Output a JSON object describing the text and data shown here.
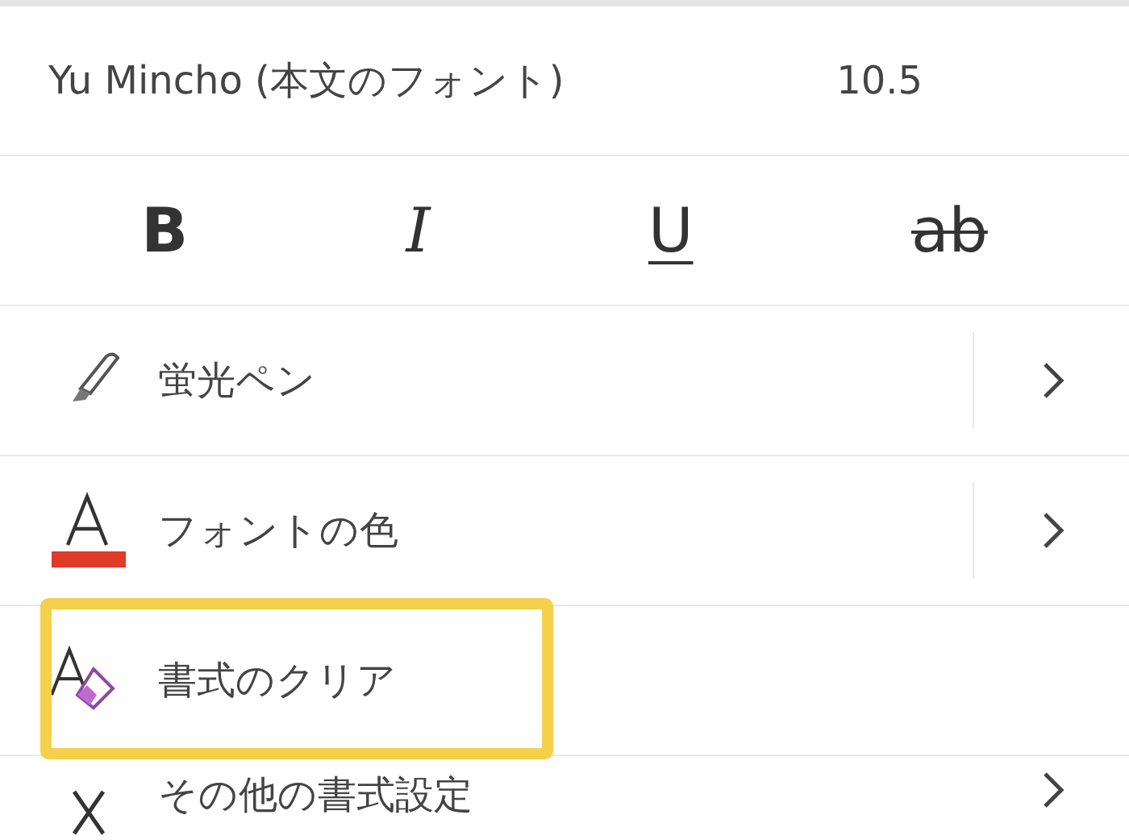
{
  "font": {
    "name": "Yu Mincho (本文のフォント)",
    "size": "10.5"
  },
  "styles": [
    {
      "kind": "bold",
      "label": "B"
    },
    {
      "kind": "italic",
      "label": "I"
    },
    {
      "kind": "underline",
      "label": "U"
    },
    {
      "kind": "strikethrough",
      "label": "ab"
    }
  ],
  "items": [
    {
      "kind": "highlighter",
      "label": "蛍光ペン",
      "submenu": true,
      "highlighted": false
    },
    {
      "kind": "font_color",
      "label": "フォントの色",
      "submenu": true,
      "highlighted": false
    },
    {
      "kind": "clear_format",
      "label": "書式のクリア",
      "submenu": false,
      "highlighted": true
    },
    {
      "kind": "more",
      "label": "その他の書式設定",
      "submenu": true,
      "highlighted": false
    }
  ]
}
